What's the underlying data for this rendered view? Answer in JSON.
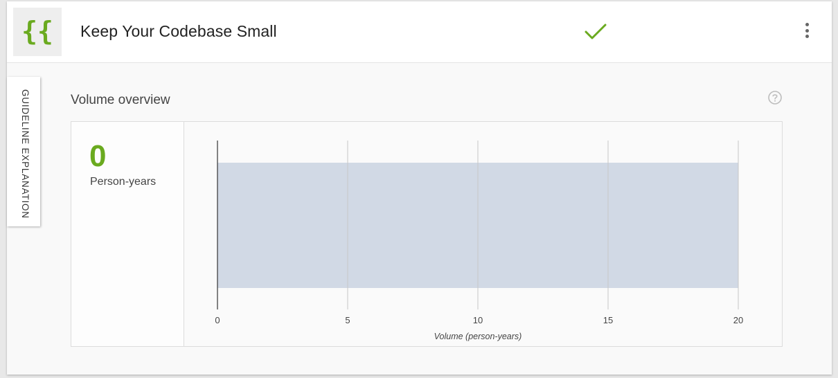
{
  "header": {
    "title": "Keep Your Codebase Small",
    "logo_icon": "curly-braces-icon",
    "status_icon": "checkmark-icon",
    "status_color": "#6aaa1f",
    "menu_icon": "more-vertical-icon"
  },
  "side_tab": {
    "label": "GUIDELINE EXPLANATION"
  },
  "section": {
    "title": "Volume overview",
    "help_icon": "help-circle-icon"
  },
  "kpi": {
    "value": "0",
    "unit": "Person-years",
    "color": "#6aaa1f"
  },
  "chart_data": {
    "type": "bar",
    "orientation": "horizontal",
    "categories": [
      ""
    ],
    "values": [
      20
    ],
    "xlabel": "Volume (person-years)",
    "ylabel": "",
    "xlim": [
      0,
      20
    ],
    "xticks": [
      0,
      5,
      10,
      15,
      20
    ],
    "grid": true,
    "bar_color": "#d1d9e5"
  }
}
